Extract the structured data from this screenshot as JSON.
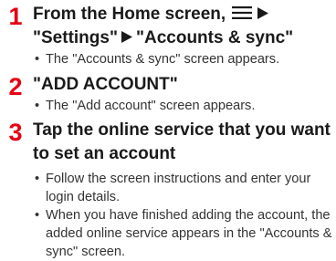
{
  "steps": [
    {
      "number": "1",
      "title_part1": "From the Home screen,",
      "title_quote1": "\"Settings\"",
      "title_quote2": "\"Accounts & sync\"",
      "bullets": [
        "The \"Accounts & sync\" screen appears."
      ]
    },
    {
      "number": "2",
      "title": "\"ADD ACCOUNT\"",
      "bullets": [
        "The \"Add account\" screen appears."
      ]
    },
    {
      "number": "3",
      "title_line1": "Tap the online service that you want",
      "title_line2": "to set an account",
      "bullets": [
        "Follow the screen instructions and enter your login details.",
        "When you have finished adding the account, the added online service appears in the \"Accounts & sync\" screen."
      ]
    }
  ],
  "bullet_glyph": "•",
  "colors": {
    "step_number": "#e60012",
    "text": "#1a1a1a"
  },
  "icons": [
    "menu-icon",
    "right-triangle-arrow-icon"
  ]
}
